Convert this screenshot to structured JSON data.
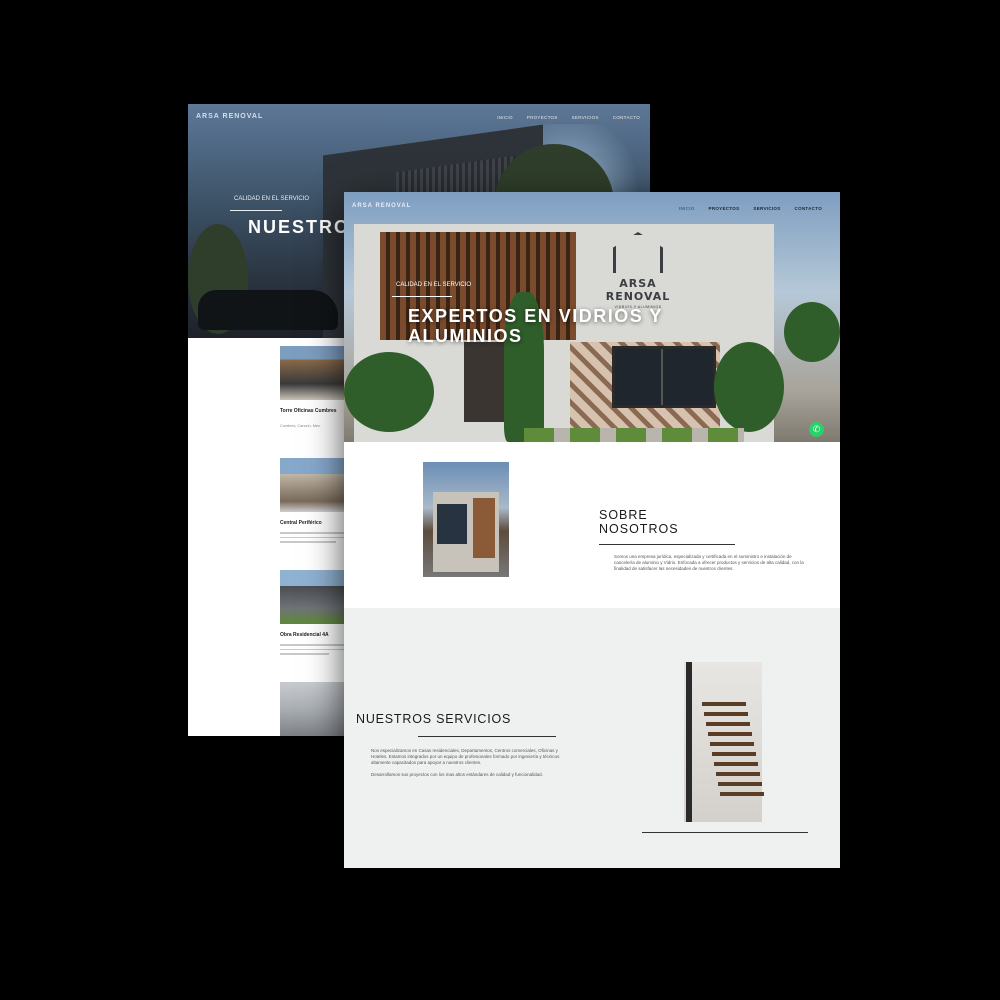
{
  "back_page": {
    "logo": "ARSA RENOVAL",
    "nav": [
      "INICIO",
      "PROYECTOS",
      "SERVICIOS",
      "CONTACTO"
    ],
    "hero_tag": "CALIDAD EN EL SERVICIO",
    "hero_title": "NUESTROS PROYECTOS",
    "projects": [
      {
        "title": "Torre Oficinas Cumbres",
        "meta": "Cumbres, Cancún, Mex."
      },
      {
        "title": "Central Periférico"
      },
      {
        "title": "Obra Residencial 4A"
      }
    ]
  },
  "front_page": {
    "logo": "ARSA RENOVAL",
    "nav": [
      "INICIO",
      "PROYECTOS",
      "SERVICIOS",
      "CONTACTO"
    ],
    "brand_name": "ARSA RENOVAL",
    "brand_sub": "VIDRIOS Y ALUMINIOS",
    "hero_tag": "CALIDAD EN EL SERVICIO",
    "hero_title": "EXPERTOS EN VIDRIOS Y ALUMINIOS",
    "whatsapp_icon": "whatsapp-icon",
    "sobre": {
      "title": "SOBRE NOSOTROS",
      "text": "Somos una empresa jurídica, especializada y certificada en el suministro e instalación de cancelería de aluminio y Vidrio. Enfocada a ofrecer productos y servicios de alta calidad, con la finalidad de satisfacer las necesidades de nuestros clientes."
    },
    "servicios": {
      "title": "NUESTROS SERVICIOS",
      "text1": "Nos especializamos en Casas residenciales, Departamentos, Centros comerciales, Oficinas y Hoteles. Estamos integrados por un equipo de profesionales formado por ingeniería y técnicos altamente capacitados para apoyar a nuestros clientes.",
      "text2": "Desarrollamos sus proyectos con los mas altos estándares de calidad y funcionalidad."
    }
  },
  "colors": {
    "whatsapp": "#25d366",
    "nav_active": "#3f6790",
    "section_bg": "#eff1f0"
  }
}
